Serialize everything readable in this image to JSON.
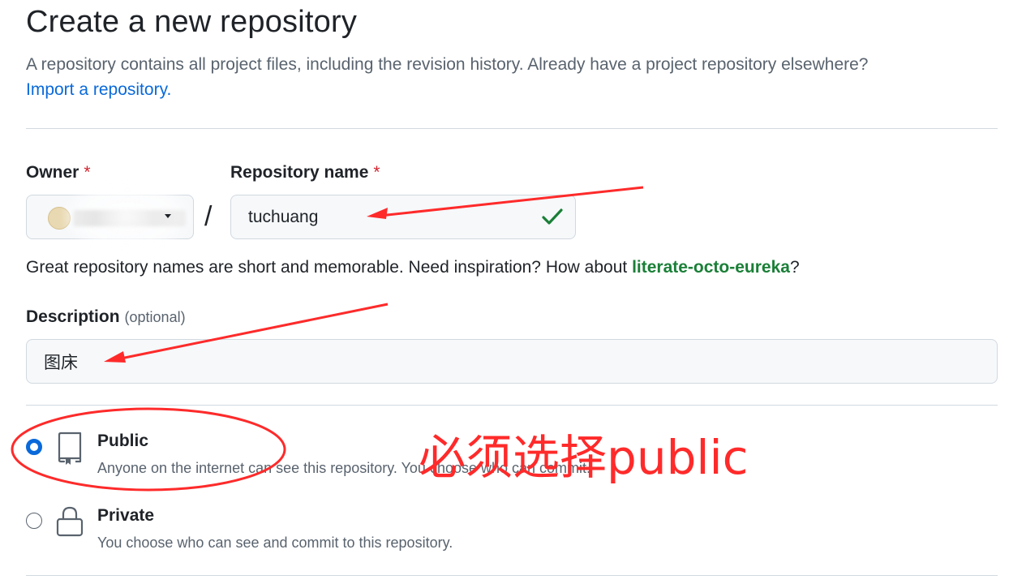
{
  "header": {
    "title": "Create a new repository",
    "subtitle": "A repository contains all project files, including the revision history. Already have a project repository elsewhere?",
    "import_link": "Import a repository."
  },
  "owner": {
    "label": "Owner",
    "required_mark": "*"
  },
  "repo_name": {
    "label": "Repository name",
    "required_mark": "*",
    "separator": "/",
    "value": "tuchuang",
    "hint_prefix": "Great repository names are short and memorable. Need inspiration? How about ",
    "suggestion": "literate-octo-eureka",
    "hint_suffix": "?"
  },
  "description": {
    "label": "Description",
    "optional_text": "(optional)",
    "value": "图床"
  },
  "visibility": {
    "public": {
      "title": "Public",
      "desc": "Anyone on the internet can see this repository. You choose who can commit.",
      "selected": true
    },
    "private": {
      "title": "Private",
      "desc": "You choose who can see and commit to this repository.",
      "selected": false
    }
  },
  "annotation": {
    "text": "必须选择public",
    "color": "#ff2a2a"
  },
  "colors": {
    "link": "#0969da",
    "success": "#1a7f37",
    "required": "#d1242f",
    "radio_selected": "#0969da"
  }
}
